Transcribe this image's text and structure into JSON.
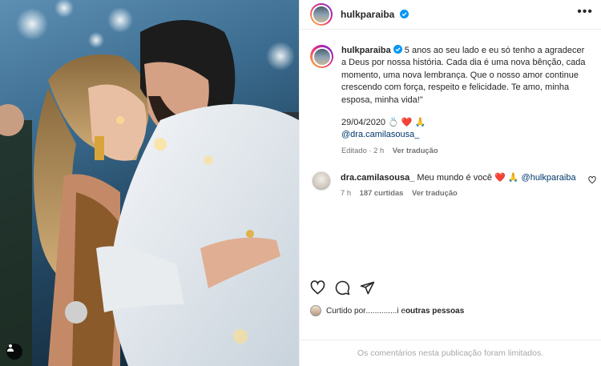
{
  "header": {
    "username": "hulkparaiba",
    "more_label": "•••"
  },
  "caption": {
    "username": "hulkparaiba",
    "text": " 5 anos ao seu lado e eu só tenho a agradecer a Deus por nossa história. Cada dia é uma nova bênção, cada momento, uma nova lembrança. Que o nosso amor continue crescendo com força, respeito e felicidade. Te amo, minha esposa, minha vida!\"",
    "date": "29/04/2020",
    "date_emojis": "💍 ❤️ 🙏",
    "mention": "@dra.camilasousa_",
    "meta_edited": "Editado · 2 h",
    "meta_translate": "Ver tradução"
  },
  "comment": {
    "username": "dra.camilasousa_",
    "text": " Meu mundo é você ",
    "emojis": "❤️ 🙏",
    "mention": "@hulkparaiba",
    "time": "7 h",
    "likes": "187 curtidas",
    "translate": "Ver tradução"
  },
  "liked_by": {
    "prefix": "Curtido por ",
    "hidden": "..............",
    "middle": "i e ",
    "others": "outras pessoas"
  },
  "comments_limited": "Os comentários nesta publicação foram limitados.",
  "icons": {
    "verified": "verified-badge-icon",
    "like": "heart-outline-icon",
    "comment": "speech-bubble-icon",
    "share": "paper-plane-icon",
    "tag": "person-tag-icon"
  },
  "colors": {
    "verified": "#0095f6",
    "heart": "#ed4956",
    "mention": "#00376b",
    "muted": "#737373"
  }
}
